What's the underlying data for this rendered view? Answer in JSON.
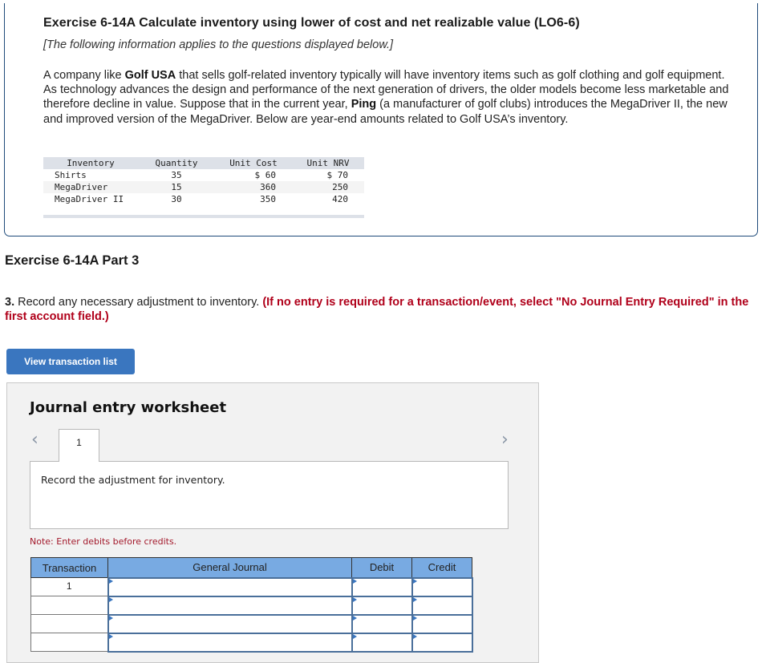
{
  "exercise": {
    "title": "Exercise 6-14A Calculate inventory using lower of cost and net realizable value (LO6-6)",
    "subtitle": "[The following information applies to the questions displayed below.]",
    "body_parts": [
      "A company like ",
      "Golf USA",
      " that sells golf-related inventory typically will have inventory items such as golf clothing and golf equipment. As technology advances the design and performance of the next generation of drivers, the older models become less marketable and therefore decline in value. Suppose that in the current year, ",
      "Ping",
      " (a manufacturer of golf clubs) introduces the MegaDriver II, the new and improved version of the MegaDriver. Below are year-end amounts related to Golf USA’s inventory."
    ],
    "inventory_table": {
      "headers": [
        "Inventory",
        "Quantity",
        "Unit Cost",
        "Unit NRV"
      ],
      "rows": [
        {
          "item": "Shirts",
          "quantity": "35",
          "unit_cost": "$ 60",
          "unit_nrv": "$ 70"
        },
        {
          "item": "MegaDriver",
          "quantity": "15",
          "unit_cost": "360",
          "unit_nrv": "250"
        },
        {
          "item": "MegaDriver II",
          "quantity": "30",
          "unit_cost": "350",
          "unit_nrv": "420"
        }
      ]
    }
  },
  "part": {
    "title": "Exercise 6-14A Part 3",
    "question_number": "3.",
    "question_text": " Record any necessary adjustment to inventory. ",
    "question_instruction": "(If no entry is required for a transaction/event, select \"No Journal Entry Required\" in the first account field.)"
  },
  "buttons": {
    "view_transaction_list": "View transaction list"
  },
  "worksheet": {
    "title": "Journal entry worksheet",
    "prev_icon": "‹",
    "next_icon": "›",
    "active_tab": "1",
    "prompt": "Record the adjustment for inventory.",
    "note": "Note: Enter debits before credits.",
    "table": {
      "headers": [
        "Transaction",
        "General Journal",
        "Debit",
        "Credit"
      ],
      "rows": [
        {
          "transaction": "1",
          "general_journal": "",
          "debit": "",
          "credit": ""
        },
        {
          "transaction": "",
          "general_journal": "",
          "debit": "",
          "credit": ""
        },
        {
          "transaction": "",
          "general_journal": "",
          "debit": "",
          "credit": ""
        },
        {
          "transaction": "",
          "general_journal": "",
          "debit": "",
          "credit": ""
        }
      ]
    }
  },
  "colors": {
    "panel_border": "#1e4a7a",
    "button_blue": "#3a76bf",
    "header_blue": "#78aae2",
    "instruction_red": "#b0001a",
    "note_red": "#a3192b"
  }
}
